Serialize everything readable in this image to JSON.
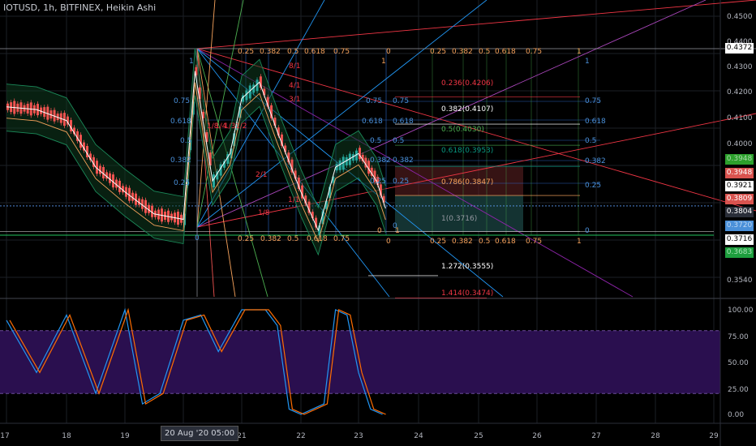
{
  "header": {
    "title": "IOTUSD, 1h, BITFINEX, Heikin Ashi"
  },
  "price_axis": {
    "ticks": [
      "0.4500",
      "0.4400",
      "0.4300",
      "0.4200",
      "0.4100",
      "0.4000",
      "0.3540"
    ],
    "tags": [
      {
        "label": "0.4372",
        "bg": "#ffffff",
        "fg": "#000000"
      },
      {
        "label": "0.3948",
        "bg": "#2ca02c",
        "fg": "#a9d8a9"
      },
      {
        "label": "0.3948",
        "bg": "#d9534f",
        "fg": "#ffffff"
      },
      {
        "label": "0.3921",
        "bg": "#ffffff",
        "fg": "#000000"
      },
      {
        "label": "0.3809",
        "bg": "#d9534f",
        "fg": "#ffffff"
      },
      {
        "label": "0.3804",
        "bg": "#2a2e39",
        "fg": "#ffffff"
      },
      {
        "label": "0.3720",
        "bg": "#4a90d9",
        "fg": "#bcd6f2"
      },
      {
        "label": "0.3716",
        "bg": "#ffffff",
        "fg": "#000000"
      },
      {
        "label": "0.3683",
        "bg": "#1e9e3e",
        "fg": "#a6e3b5"
      }
    ]
  },
  "osc_axis": {
    "ticks": [
      "100.00",
      "75.00",
      "50.00",
      "25.00",
      "0.00"
    ]
  },
  "time_axis": {
    "ticks": [
      "17",
      "18",
      "19",
      "21",
      "22",
      "23",
      "24",
      "25",
      "26",
      "27",
      "28",
      "29"
    ],
    "cursor_label": "20 Aug '20   05:00"
  },
  "fib_retracement": {
    "levels": [
      {
        "label": "0.236(0.4206)",
        "color": "#f23645"
      },
      {
        "label": "0.382(0.4107)",
        "color": "#ffffff"
      },
      {
        "label": "0.5(0.4030)",
        "color": "#4caf50"
      },
      {
        "label": "0.618(0.3953)",
        "color": "#089981"
      },
      {
        "label": "0.786(0.3847)",
        "color": "#f7a35c"
      },
      {
        "label": "1(0.3716)",
        "color": "#9598a1"
      },
      {
        "label": "1.272(0.3555)",
        "color": "#ffffff"
      },
      {
        "label": "1.414(0.3474)",
        "color": "#f23645"
      }
    ]
  },
  "gann_labels": {
    "top_left": [
      "0.25",
      "0.382",
      "0.5",
      "0.618",
      "0.75",
      "0",
      "1"
    ],
    "top_right": [
      "0.25",
      "0.382",
      "0.5",
      "0.618",
      "0.75",
      "1"
    ],
    "bottom_left": [
      "0.25",
      "0.382",
      "0.5",
      "0.618",
      "0.75",
      "0",
      "1"
    ],
    "bottom_right": [
      "0",
      "0.25",
      "0.382",
      "0.5",
      "0.618",
      "0.75",
      "1"
    ],
    "left_side": [
      "1",
      "0.75",
      "0.618",
      "0.5",
      "0.382",
      "0.25",
      "0"
    ],
    "right_side": [
      "1",
      "0.75",
      "0.618",
      "0.5",
      "0.382",
      "0.25",
      "0"
    ],
    "mid": [
      "0.75",
      "0.75",
      "0.618",
      "0.618",
      "0.5",
      "0.5",
      "0.382",
      "0.382",
      "0.25",
      "0.25",
      "0"
    ],
    "fan": [
      "8/1",
      "4/1",
      "3/1",
      "1/8",
      "1/4",
      "1/3",
      "1/2",
      "2/1",
      "1/1",
      "1/8"
    ]
  },
  "chart_data": {
    "type": "line",
    "title": "IOTUSD, 1h, BITFINEX, Heikin Ashi",
    "price_range": [
      0.354,
      0.45
    ],
    "stoch_levels": {
      "upper": 80,
      "lower": 20
    },
    "series": [
      {
        "name": "",
        "x": [
          17.0,
          17.5,
          18.0,
          18.5,
          19.0,
          19.5,
          20.0,
          20.2,
          20.5,
          20.8,
          21.0,
          21.3,
          21.6,
          22.0,
          22.3,
          22.6,
          23.0,
          23.3,
          23.45
        ],
        "y": [
          0.417,
          0.416,
          0.412,
          0.395,
          0.386,
          0.378,
          0.376,
          0.43,
          0.39,
          0.4,
          0.42,
          0.426,
          0.408,
          0.386,
          0.372,
          0.395,
          0.4,
          0.39,
          0.38
        ]
      },
      {
        "name": "",
        "x": [
          17.0,
          17.5,
          18.0,
          18.5,
          19.0,
          19.3,
          19.6,
          20.0,
          20.3,
          20.6,
          21.0,
          21.2,
          21.4,
          21.6,
          21.8,
          22.0,
          22.2,
          22.4,
          22.6,
          22.8,
          23.0,
          23.2,
          23.4
        ],
        "y": [
          90,
          40,
          95,
          20,
          100,
          10,
          20,
          90,
          95,
          60,
          100,
          100,
          100,
          85,
          5,
          0,
          5,
          10,
          100,
          95,
          40,
          5,
          0
        ]
      }
    ]
  }
}
